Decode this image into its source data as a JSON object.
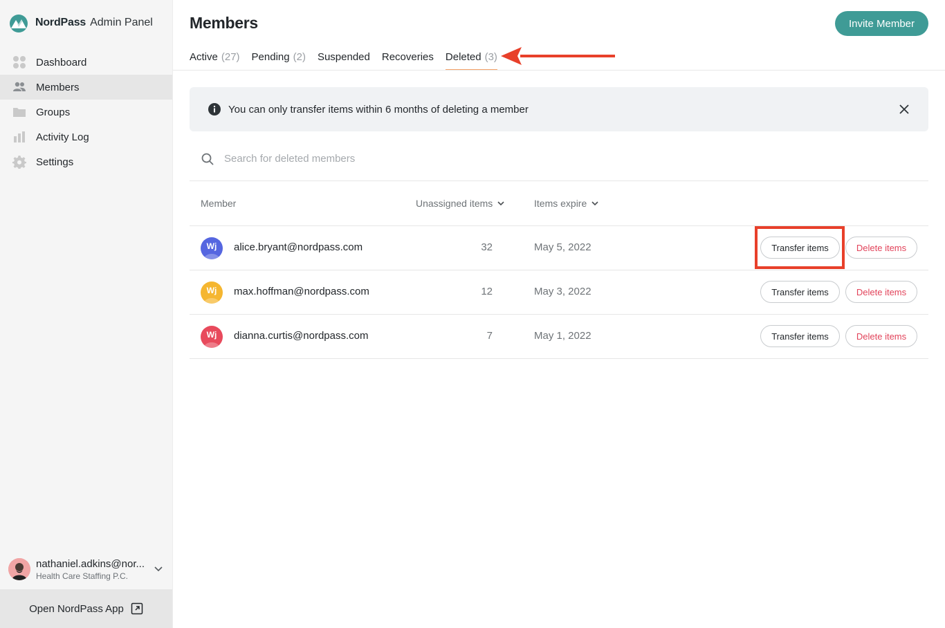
{
  "sidebar": {
    "brand_name": "NordPass",
    "brand_sub": "Admin Panel",
    "items": [
      {
        "label": "Dashboard",
        "icon": "dashboard-icon"
      },
      {
        "label": "Members",
        "icon": "members-icon"
      },
      {
        "label": "Groups",
        "icon": "folder-icon"
      },
      {
        "label": "Activity Log",
        "icon": "bar-chart-icon"
      },
      {
        "label": "Settings",
        "icon": "gear-icon"
      }
    ],
    "active_item": "Members",
    "account": {
      "email": "nathaniel.adkins@nor...",
      "org": "Health Care Staffing P.C."
    },
    "open_app_label": "Open NordPass App"
  },
  "header": {
    "title": "Members",
    "invite_label": "Invite Member"
  },
  "tabs": [
    {
      "label": "Active",
      "count": "(27)"
    },
    {
      "label": "Pending",
      "count": "(2)"
    },
    {
      "label": "Suspended",
      "count": ""
    },
    {
      "label": "Recoveries",
      "count": ""
    },
    {
      "label": "Deleted",
      "count": "(3)"
    }
  ],
  "active_tab": "Deleted",
  "banner": {
    "text": "You can only transfer items within 6 months of deleting a member"
  },
  "search": {
    "placeholder": "Search for deleted members",
    "value": ""
  },
  "table": {
    "columns": [
      "Member",
      "Unassigned items",
      "Items expire"
    ],
    "rows": [
      {
        "initials": "Wj",
        "email": "alice.bryant@nordpass.com",
        "unassigned": "32",
        "expire": "May 5, 2022",
        "transfer_label": "Transfer items",
        "delete_label": "Delete items",
        "avatar_color": "#5566e0"
      },
      {
        "initials": "Wj",
        "email": "max.hoffman@nordpass.com",
        "unassigned": "12",
        "expire": "May 3, 2022",
        "transfer_label": "Transfer items",
        "delete_label": "Delete items",
        "avatar_color": "#f5b630"
      },
      {
        "initials": "Wj",
        "email": "dianna.curtis@nordpass.com",
        "unassigned": "7",
        "expire": "May 1, 2022",
        "transfer_label": "Transfer items",
        "delete_label": "Delete items",
        "avatar_color": "#e84a5c"
      }
    ]
  },
  "colors": {
    "accent": "#3f9b96",
    "tab_underline": "#f5a268",
    "delete_text": "#e2435a",
    "annotation_red": "#e8402a"
  }
}
